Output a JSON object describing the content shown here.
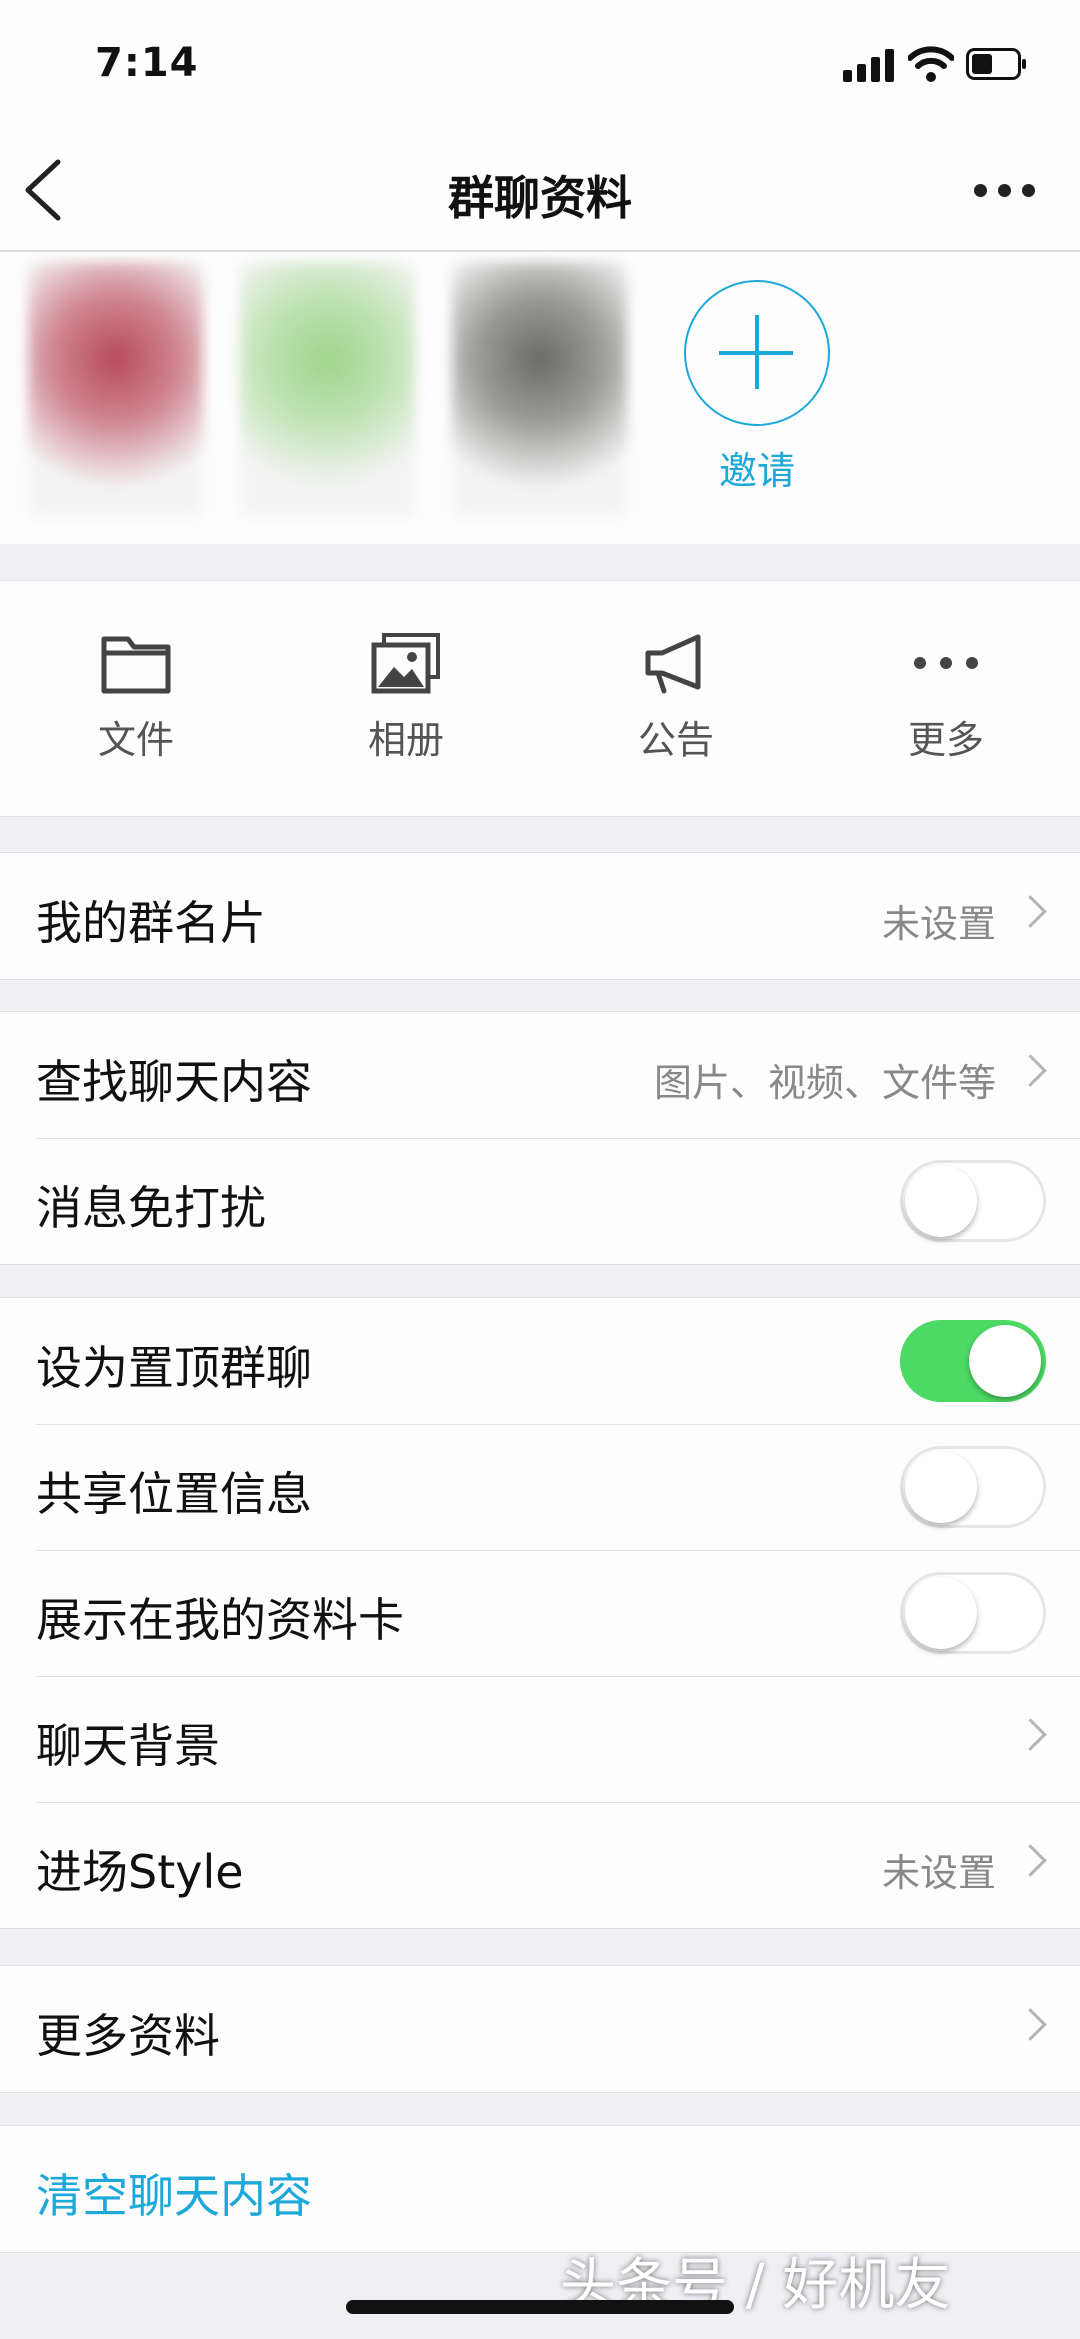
{
  "status_bar": {
    "time": "7:14"
  },
  "nav": {
    "title": "群聊资料"
  },
  "members": {
    "avatars": [
      {
        "color": "#b84a5a"
      },
      {
        "color": "#9ed58c"
      },
      {
        "color": "#6a6a66"
      }
    ],
    "invite_label": "邀请"
  },
  "actions": [
    {
      "label": "文件",
      "icon": "folder-icon"
    },
    {
      "label": "相册",
      "icon": "photo-album-icon"
    },
    {
      "label": "公告",
      "icon": "megaphone-icon"
    },
    {
      "label": "更多",
      "icon": "more-dots-icon"
    }
  ],
  "rows": {
    "my_card": {
      "label": "我的群名片",
      "value": "未设置"
    },
    "search_history": {
      "label": "查找聊天内容",
      "value": "图片、视频、文件等"
    },
    "mute": {
      "label": "消息免打扰",
      "on": false
    },
    "pin": {
      "label": "设为置顶群聊",
      "on": true
    },
    "share_location": {
      "label": "共享位置信息",
      "on": false
    },
    "show_on_profile": {
      "label": "展示在我的资料卡",
      "on": false
    },
    "chat_background": {
      "label": "聊天背景"
    },
    "entrance_style": {
      "label": "进场Style",
      "value": "未设置"
    },
    "more_info": {
      "label": "更多资料"
    },
    "clear_history": {
      "label": "清空聊天内容"
    }
  },
  "watermark": "头条号 / 好机友",
  "colors": {
    "accent": "#1ca8d9",
    "toggle_on": "#4cd964",
    "background": "#efeff4"
  }
}
